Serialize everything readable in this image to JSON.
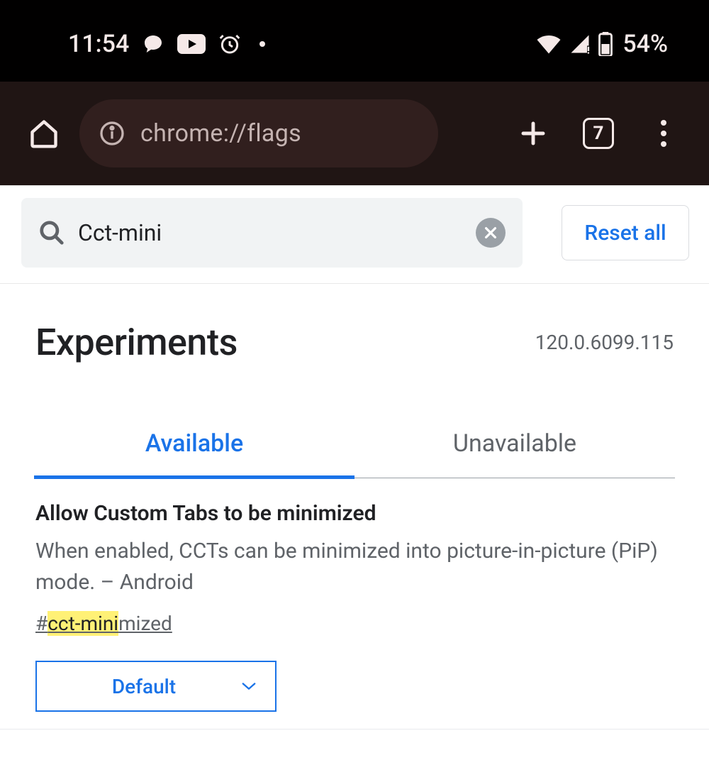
{
  "statusbar": {
    "time": "11:54",
    "battery_pct": "54%"
  },
  "toolbar": {
    "url": "chrome://flags",
    "tab_count": "7"
  },
  "search": {
    "value": "Cct-mini",
    "reset_label": "Reset all"
  },
  "header": {
    "title": "Experiments",
    "version": "120.0.6099.115"
  },
  "tabs": {
    "available": "Available",
    "unavailable": "Unavailable"
  },
  "flag": {
    "title": "Allow Custom Tabs to be minimized",
    "description": "When enabled, CCTs can be minimized into picture-in-picture (PiP) mode. – Android",
    "anchor_prefix": "#",
    "anchor_highlight": "cct-mini",
    "anchor_suffix": "mized",
    "select_value": "Default"
  }
}
